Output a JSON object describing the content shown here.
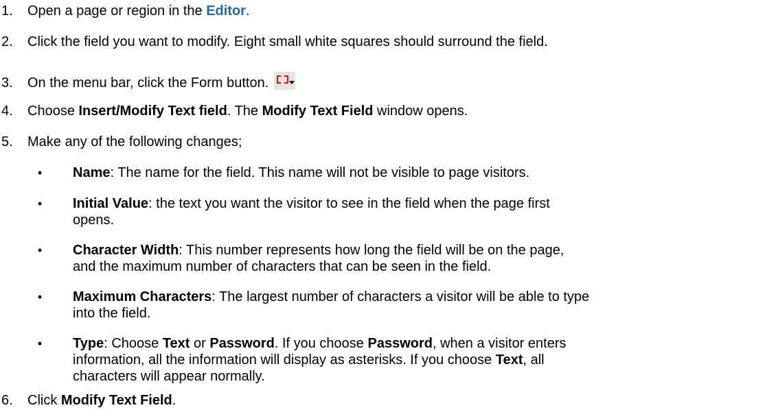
{
  "steps": [
    {
      "num": "1.",
      "pre": "Open a page or region in the ",
      "link": "Editor",
      "post": "."
    },
    {
      "num": "2.",
      "text": "Click the field you want to modify. Eight small white squares should surround the field."
    },
    {
      "num": "3.",
      "text": "On the menu bar, click the Form button.",
      "icon": "form-button-icon"
    },
    {
      "num": "4.",
      "pre": "Choose ",
      "b1": "Insert/Modify Text field",
      "mid": ". The ",
      "b2": "Modify Text Field",
      "post": " window opens."
    },
    {
      "num": "5.",
      "text": "Make any of the following changes;"
    },
    {
      "num": "6.",
      "pre": "Click ",
      "b1": "Modify Text Field",
      "post": "."
    }
  ],
  "bullets": [
    {
      "term": "Name",
      "lines": [
        ": The name for the field. This name will not be visible to page visitors."
      ]
    },
    {
      "term": "Initial Value",
      "lines": [
        ": the text you want the visitor to see in the field when the page first",
        "opens."
      ]
    },
    {
      "term": "Character Width",
      "lines": [
        ":  This number represents how long the field will be on the page,",
        "and the maximum number of characters that can be seen in the field."
      ]
    },
    {
      "term": "Maximum Characters",
      "lines": [
        ": The largest number of characters a visitor will be able to type",
        "into the field."
      ]
    },
    {
      "term": "Type",
      "type_parts": {
        "p1": ": Choose ",
        "b1": "Text",
        "p2": " or ",
        "b2": "Password",
        "p3": ". If you choose ",
        "b3": "Password",
        "p4": ", when a visitor enters",
        "line2": "information, all the information will display as asterisks. If you choose ",
        "b4": "Text",
        "p5": ", all",
        "line3": "characters will appear normally."
      }
    }
  ],
  "bullet_glyph": "•"
}
